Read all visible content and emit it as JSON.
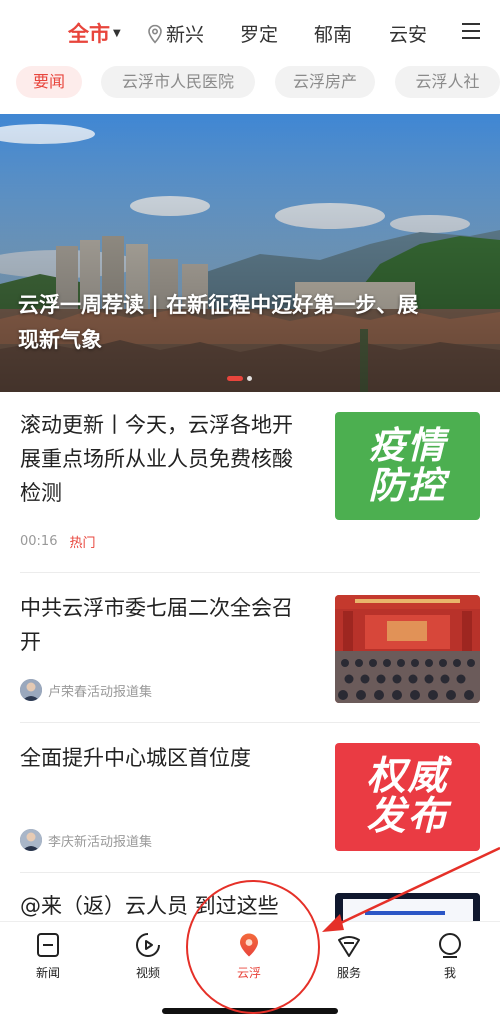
{
  "header": {
    "current_city": "全市",
    "cities": [
      "新兴",
      "罗定",
      "郁南",
      "云安"
    ]
  },
  "channels": [
    "要闻",
    "云浮市人民医院",
    "云浮房产",
    "云浮人社"
  ],
  "banner": {
    "title": "云浮一周荐读 | 在新征程中迈好第一步、展现新气象"
  },
  "news": [
    {
      "title": "滚动更新丨今天，云浮各地开展重点场所从业人员免费核酸检测",
      "time": "00:16",
      "tag": "热门",
      "thumb_text": [
        "疫情",
        "防控"
      ]
    },
    {
      "title": "中共云浮市委七届二次全会召开",
      "source": "卢荣春活动报道集"
    },
    {
      "title": "全面提升中心城区首位度",
      "source": "李庆新活动报道集",
      "thumb_text": [
        "权威",
        "发布"
      ]
    },
    {
      "title": "@来（返）云人员 到过这些"
    }
  ],
  "tabbar": {
    "items": [
      {
        "label": "新闻",
        "icon": "news-icon"
      },
      {
        "label": "视频",
        "icon": "video-icon"
      },
      {
        "label": "云浮",
        "icon": "location-pin-icon",
        "active": true
      },
      {
        "label": "服务",
        "icon": "service-icon"
      },
      {
        "label": "我",
        "icon": "profile-icon"
      }
    ]
  },
  "colors": {
    "accent": "#e8453c",
    "annotation": "#e53028",
    "green_thumb": "#4caf50",
    "red_thumb": "#ea3b43"
  }
}
